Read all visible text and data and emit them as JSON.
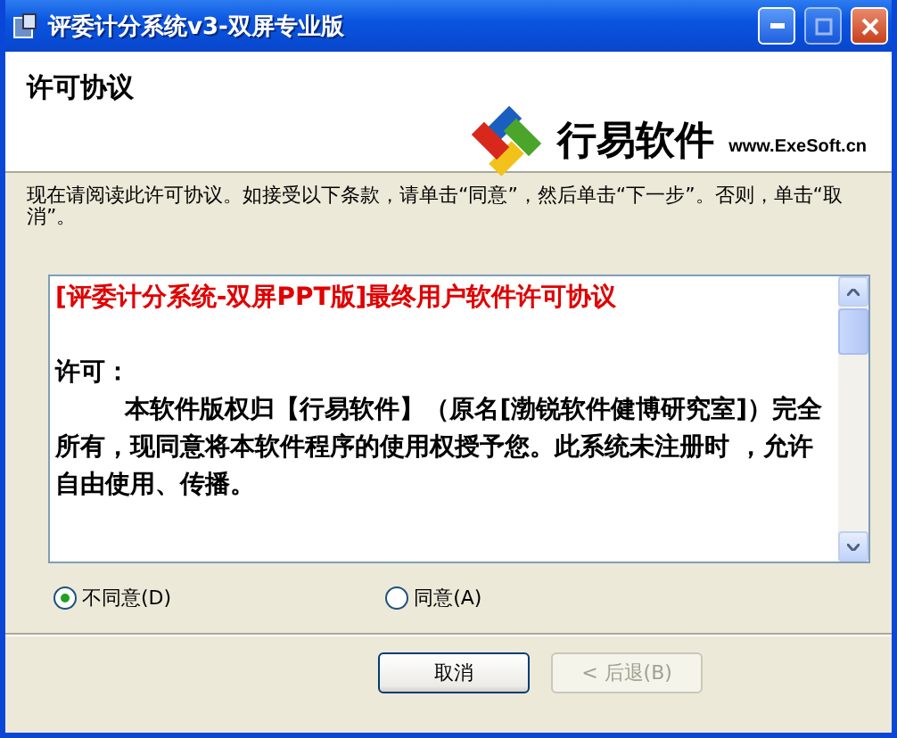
{
  "window": {
    "title": "评委计分系统v3-双屏专业版"
  },
  "header": {
    "title": "许可协议",
    "brand": "行易软件",
    "website": "www.ExeSoft.cn"
  },
  "instruction": "现在请阅读此许可协议。如接受以下条款，请单击“同意”，然后单击“下一步”。否则，单击“取消”。",
  "license": {
    "heading": "[评委计分系统-双屏PPT版]最终用户软件许可协议",
    "paragraphs": [
      {
        "kind": "label",
        "text": "许可："
      },
      {
        "kind": "body",
        "text": "本软件版权归【行易软件】（原名[渤锐软件健博研究室]）完全所有，现同意将本软件程序的使用权授予您。此系统未注册时 ，允许自由使用、传播。"
      }
    ]
  },
  "options": [
    {
      "label": "不同意(D)",
      "selected": true
    },
    {
      "label": "同意(A)",
      "selected": false
    }
  ],
  "buttons": [
    {
      "label": "取消",
      "disabled": false
    },
    {
      "label": "< 后退(B)",
      "disabled": true
    }
  ]
}
